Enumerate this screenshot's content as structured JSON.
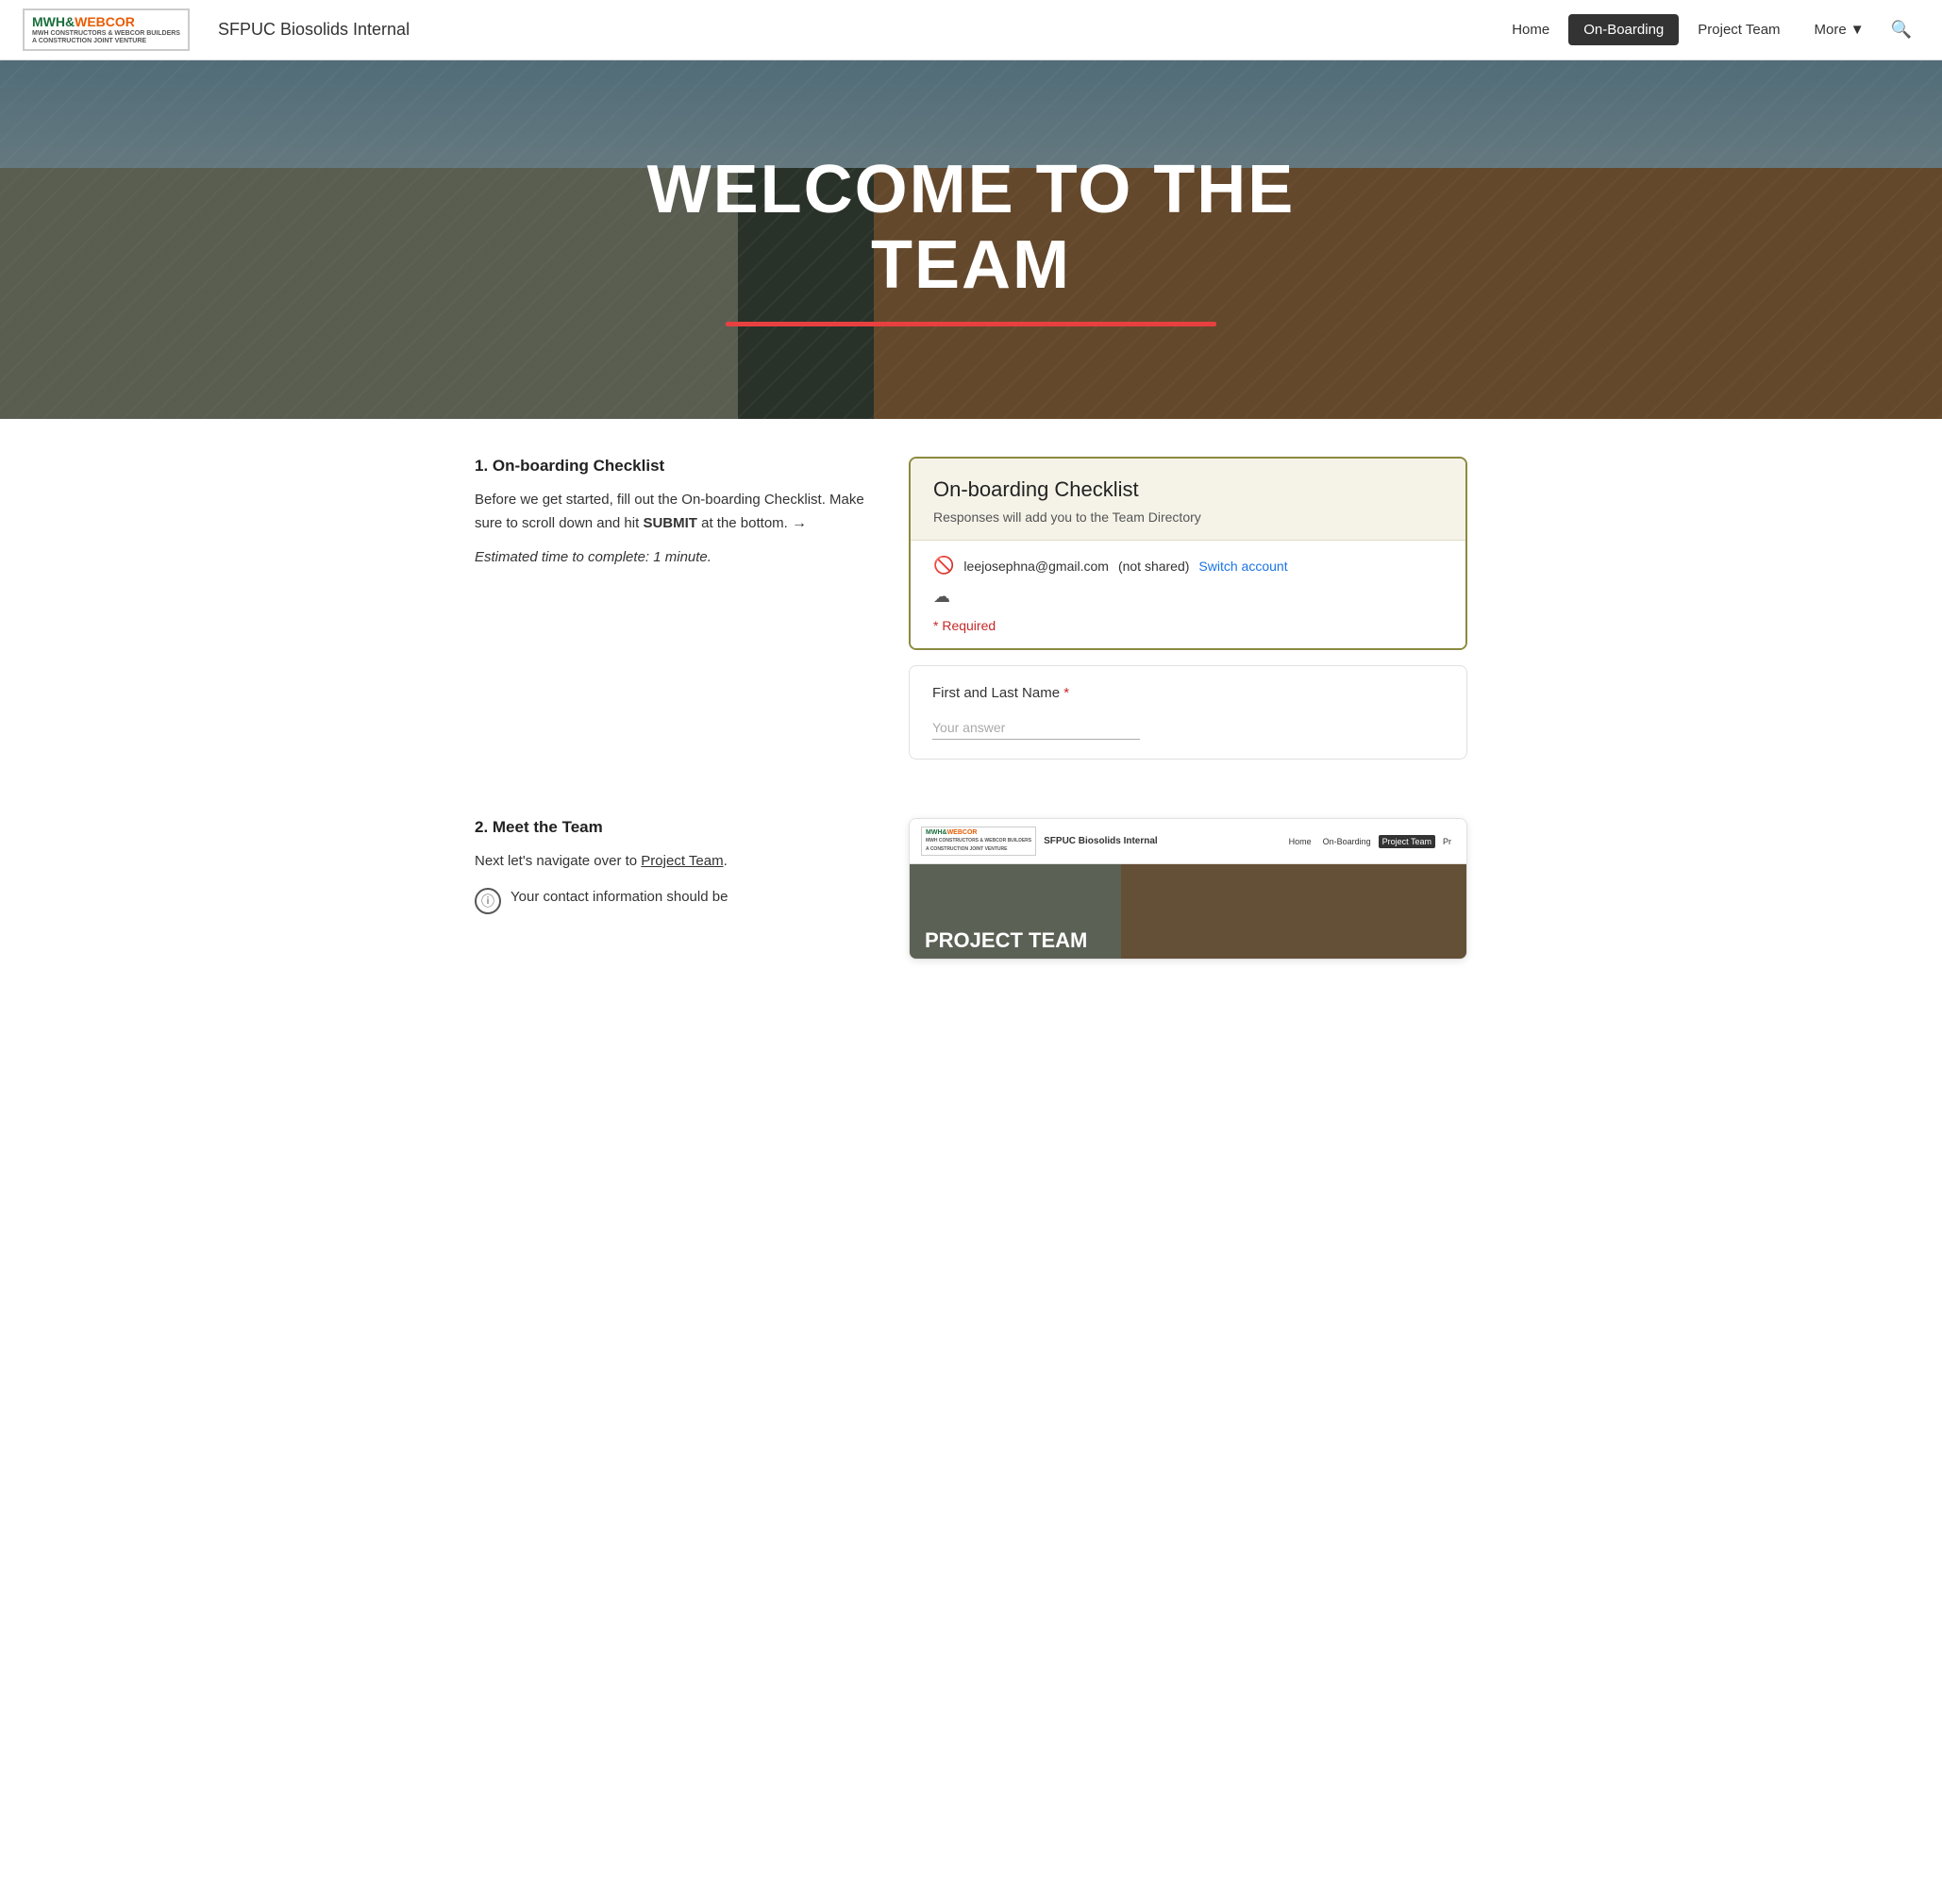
{
  "navbar": {
    "logo_mwh": "MWH",
    "logo_ampersand": "&",
    "logo_webcor": "WEBCOR",
    "logo_sub1": "MWH CONSTRUCTORS & WEBCOR BUILDERS",
    "logo_sub2": "A CONSTRUCTION JOINT VENTURE",
    "site_title": "SFPUC Biosolids Internal",
    "nav_home": "Home",
    "nav_onboarding": "On-Boarding",
    "nav_project_team": "Project Team",
    "nav_more": "More",
    "search_icon": "🔍"
  },
  "hero": {
    "title_line1": "WELCOME TO THE",
    "title_line2": "TEAM"
  },
  "section1": {
    "heading": "1. On-boarding Checklist",
    "body1": "Before we get started, fill out the On-boarding Checklist. Make sure to scroll down and hit",
    "submit_bold": "SUBMIT",
    "body2": "at the bottom.",
    "arrow": "→",
    "italic": "Estimated time to complete: 1 minute."
  },
  "form_card": {
    "title": "On-boarding Checklist",
    "subtitle": "Responses will add you to the Team Directory",
    "email": "leejosephna@gmail.com",
    "not_shared": "(not shared)",
    "switch_account": "Switch account",
    "required_text": "* Required"
  },
  "form_field": {
    "label": "First and Last Name",
    "required_star": "*",
    "placeholder": "Your answer"
  },
  "section2": {
    "heading": "2. Meet the Team",
    "body": "Next let's navigate over to",
    "link": "Project Team",
    "body2": ".",
    "body3": "Your contact information should be"
  },
  "mini_browser": {
    "logo_mwh": "MWH",
    "logo_webcor": "WEBCOR",
    "logo_sub1": "MWH CONSTRUCTORS & WEBCOR BUILDERS",
    "logo_sub2": "A CONSTRUCTION JOINT VENTURE",
    "site_title": "SFPUC Biosolids Internal",
    "nav_home": "Home",
    "nav_onboarding": "On-Boarding",
    "nav_active": "Project Team",
    "nav_pr": "Pr",
    "hero_text_line1": "PROJECT TEAM"
  }
}
